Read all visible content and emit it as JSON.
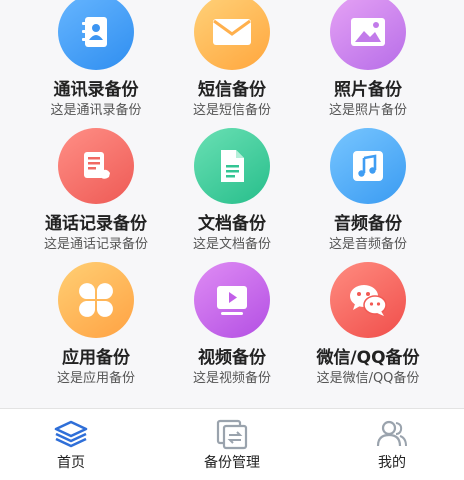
{
  "items": [
    {
      "title": "通讯录备份",
      "subtitle": "这是通讯录备份",
      "icon": "contacts-icon"
    },
    {
      "title": "短信备份",
      "subtitle": "这是短信备份",
      "icon": "envelope-icon"
    },
    {
      "title": "照片备份",
      "subtitle": "这是照片备份",
      "icon": "image-icon"
    },
    {
      "title": "通话记录备份",
      "subtitle": "这是通话记录备份",
      "icon": "call-log-icon"
    },
    {
      "title": "文档备份",
      "subtitle": "这是文档备份",
      "icon": "document-icon"
    },
    {
      "title": "音频备份",
      "subtitle": "这是音频备份",
      "icon": "music-icon"
    },
    {
      "title": "应用备份",
      "subtitle": "这是应用备份",
      "icon": "apps-icon"
    },
    {
      "title": "视频备份",
      "subtitle": "这是视频备份",
      "icon": "video-icon"
    },
    {
      "title": "微信/QQ备份",
      "subtitle": "这是微信/QQ备份",
      "icon": "chat-icon"
    }
  ],
  "tabs": [
    {
      "label": "首页",
      "icon": "layers-icon",
      "active": true
    },
    {
      "label": "备份管理",
      "icon": "sync-icon",
      "active": false
    },
    {
      "label": "我的",
      "icon": "users-icon",
      "active": false
    }
  ],
  "colors": {
    "active_tab": "#2f6fd8",
    "inactive_tab": "#9aa3ad"
  }
}
